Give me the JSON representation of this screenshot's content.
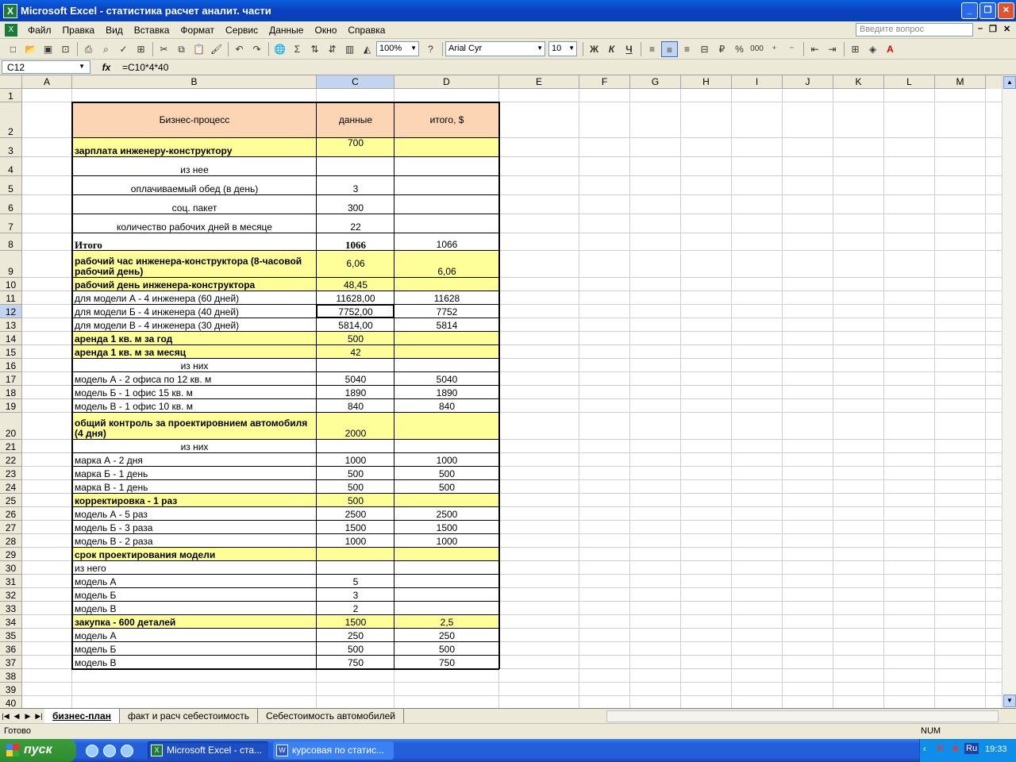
{
  "window": {
    "title": "Microsoft Excel - статистика расчет аналит. части"
  },
  "menu": {
    "items": [
      "Файл",
      "Правка",
      "Вид",
      "Вставка",
      "Формат",
      "Сервис",
      "Данные",
      "Окно",
      "Справка"
    ],
    "ask_placeholder": "Введите вопрос"
  },
  "toolbar": {
    "zoom": "100%",
    "font": "Arial Cyr",
    "size": "10",
    "bold": "Ж",
    "italic": "К",
    "underline": "Ч",
    "percent": "%",
    "thousands": "000"
  },
  "formula_bar": {
    "name_box": "C12",
    "fx": "fx",
    "formula": "=C10*4*40"
  },
  "columns": [
    "A",
    "B",
    "C",
    "D",
    "E",
    "F",
    "G",
    "H",
    "I",
    "J",
    "K",
    "L",
    "M"
  ],
  "rows": [
    "1",
    "2",
    "3",
    "4",
    "5",
    "6",
    "7",
    "8",
    "9",
    "10",
    "11",
    "12",
    "13",
    "14",
    "15",
    "16",
    "17",
    "18",
    "19",
    "20",
    "21",
    "22",
    "23",
    "24",
    "25",
    "26",
    "27",
    "28",
    "29",
    "30",
    "31",
    "32",
    "33",
    "34",
    "35",
    "36",
    "37",
    "38",
    "39",
    "40"
  ],
  "table": {
    "header": {
      "b": "Бизнес-процесс",
      "c": "данные",
      "d": "итого, $"
    },
    "rows": [
      {
        "r": 3,
        "b": "зарплата инженеру-конструктору",
        "c": "700",
        "d": ""
      },
      {
        "r": 4,
        "b": "из нее",
        "c": "",
        "d": ""
      },
      {
        "r": 5,
        "b": "оплачиваемый обед (в день)",
        "c": "3",
        "d": ""
      },
      {
        "r": 6,
        "b": "соц. пакет",
        "c": "300",
        "d": ""
      },
      {
        "r": 7,
        "b": "количество рабочих дней в месяце",
        "c": "22",
        "d": ""
      },
      {
        "r": 8,
        "b": "Итого",
        "c": "1066",
        "d": "1066"
      },
      {
        "r": 9,
        "b": "рабочий час инженера-конструктора (8-часовой рабочий день)",
        "c": "6,06",
        "d": "6,06"
      },
      {
        "r": 10,
        "b": "рабочий день инженера-конструктора",
        "c": "48,45",
        "d": ""
      },
      {
        "r": 11,
        "b": "для модели А - 4 инженера (60 дней)",
        "c": "11628,00",
        "d": "11628"
      },
      {
        "r": 12,
        "b": "для модели Б - 4 инженера (40 дней)",
        "c": "7752,00",
        "d": "7752"
      },
      {
        "r": 13,
        "b": "для модели В - 4 инженера (30 дней)",
        "c": "5814,00",
        "d": "5814"
      },
      {
        "r": 14,
        "b": "аренда 1 кв. м за год",
        "c": "500",
        "d": ""
      },
      {
        "r": 15,
        "b": "аренда 1 кв. м за месяц",
        "c": "42",
        "d": ""
      },
      {
        "r": 16,
        "b": "из них",
        "c": "",
        "d": ""
      },
      {
        "r": 17,
        "b": "модель А - 2 офиса по 12 кв. м",
        "c": "5040",
        "d": "5040"
      },
      {
        "r": 18,
        "b": "модель Б - 1 офис 15 кв. м",
        "c": "1890",
        "d": "1890"
      },
      {
        "r": 19,
        "b": "модель В - 1 офис 10 кв. м",
        "c": "840",
        "d": "840"
      },
      {
        "r": 20,
        "b": "общий контроль за проектировнием автомобиля (4 дня)",
        "c": "2000",
        "d": ""
      },
      {
        "r": 21,
        "b": "из них",
        "c": "",
        "d": ""
      },
      {
        "r": 22,
        "b": "марка А - 2 дня",
        "c": "1000",
        "d": "1000"
      },
      {
        "r": 23,
        "b": "марка Б - 1 день",
        "c": "500",
        "d": "500"
      },
      {
        "r": 24,
        "b": "марка В - 1 день",
        "c": "500",
        "d": "500"
      },
      {
        "r": 25,
        "b": "корректировка - 1 раз",
        "c": "500",
        "d": ""
      },
      {
        "r": 26,
        "b": "модель А - 5 раз",
        "c": "2500",
        "d": "2500"
      },
      {
        "r": 27,
        "b": "модель Б - 3 раза",
        "c": "1500",
        "d": "1500"
      },
      {
        "r": 28,
        "b": "модель В - 2 раза",
        "c": "1000",
        "d": "1000"
      },
      {
        "r": 29,
        "b": "срок проектирования модели",
        "c": "",
        "d": ""
      },
      {
        "r": 30,
        "b": "из него",
        "c": "",
        "d": ""
      },
      {
        "r": 31,
        "b": "модель А",
        "c": "5",
        "d": ""
      },
      {
        "r": 32,
        "b": "модель Б",
        "c": "3",
        "d": ""
      },
      {
        "r": 33,
        "b": "модель В",
        "c": "2",
        "d": ""
      },
      {
        "r": 34,
        "b": "закупка - 600 деталей",
        "c": "1500",
        "d": "2,5"
      },
      {
        "r": 35,
        "b": "модель А",
        "c": "250",
        "d": "250"
      },
      {
        "r": 36,
        "b": "модель Б",
        "c": "500",
        "d": "500"
      },
      {
        "r": 37,
        "b": "модель В",
        "c": "750",
        "d": "750"
      }
    ]
  },
  "sheets": {
    "tabs": [
      "бизнес-план",
      "факт и расч себестоимость",
      "Себестоимость автомобилей"
    ]
  },
  "status": {
    "ready": "Готово",
    "num": "NUM"
  },
  "taskbar": {
    "start": "пуск",
    "tasks": [
      "Microsoft Excel - ста...",
      "курсовая по статис..."
    ],
    "lang": "Ru",
    "time": "19:33"
  },
  "colors": {
    "header_fill": "#fcd5b4",
    "yellow_fill": "#ffff99",
    "title_blue": "#0a3fbd",
    "start_green": "#3c9d3c"
  }
}
